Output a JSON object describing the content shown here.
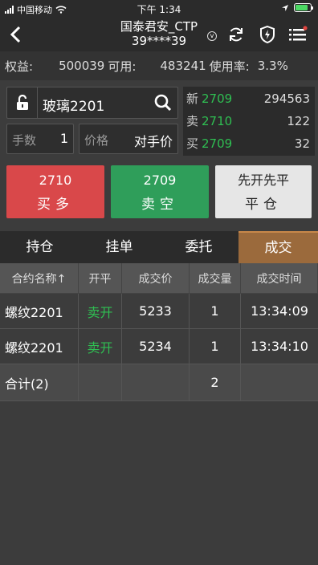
{
  "status_bar": {
    "carrier": "中国移动",
    "time": "下午 1:34"
  },
  "nav": {
    "title": "国泰君安_CTP",
    "subtitle": "39****39"
  },
  "account": {
    "equity_label": "权益:",
    "equity_value": "500039",
    "available_label": "可用:",
    "available_value": "483241",
    "usage_label": "使用率:",
    "usage_value": "3.3%"
  },
  "order": {
    "symbol": "玻璃2201",
    "qty_label": "手数",
    "qty_value": "1",
    "price_label": "价格",
    "price_value": "对手价"
  },
  "quotes": [
    {
      "label": "新",
      "price": "2709",
      "volume": "294563"
    },
    {
      "label": "卖",
      "price": "2710",
      "volume": "122"
    },
    {
      "label": "买",
      "price": "2709",
      "volume": "32"
    }
  ],
  "actions": {
    "buy_price": "2710",
    "buy_label": "买多",
    "sell_price": "2709",
    "sell_label": "卖空",
    "close_mode": "先开先平",
    "close_label": "平仓"
  },
  "tabs": [
    {
      "label": "持仓",
      "active": false
    },
    {
      "label": "挂单",
      "active": false
    },
    {
      "label": "委托",
      "active": false
    },
    {
      "label": "成交",
      "active": true
    }
  ],
  "table": {
    "headers": [
      "合约名称↑",
      "开平",
      "成交价",
      "成交量",
      "成交时间"
    ],
    "rows": [
      {
        "contract": "螺纹2201",
        "open_close": "卖开",
        "price": "5233",
        "qty": "1",
        "time": "13:34:09"
      },
      {
        "contract": "螺纹2201",
        "open_close": "卖开",
        "price": "5234",
        "qty": "1",
        "time": "13:34:10"
      }
    ],
    "total": {
      "label": "合计(2)",
      "qty": "2"
    }
  },
  "colors": {
    "buy": "#d9484a",
    "sell": "#2f9e5a",
    "price_green": "#2fbf52",
    "active_tab": "#9b6a3c"
  }
}
